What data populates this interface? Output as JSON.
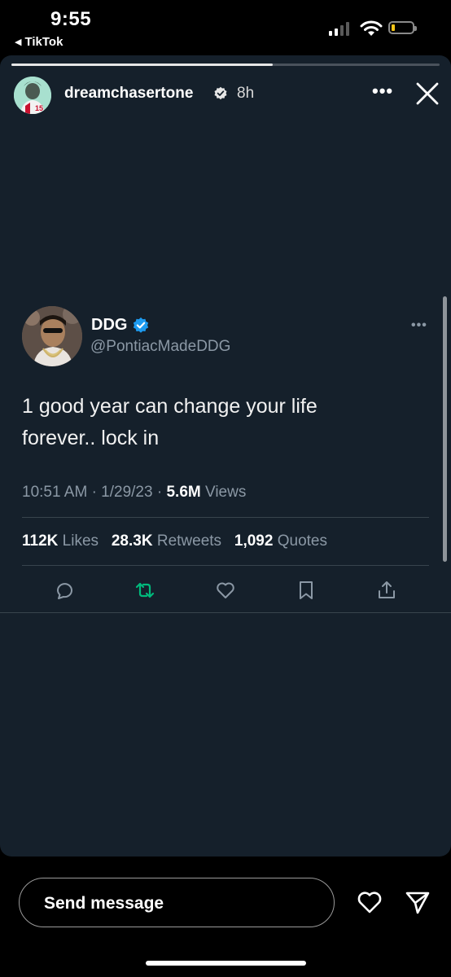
{
  "status_bar": {
    "time": "9:55",
    "back_app": "TikTok",
    "back_arrow": "◀",
    "signal_icon": "cellular-signal-icon",
    "wifi_icon": "wifi-icon",
    "battery_icon": "battery-low-icon",
    "battery_color": "#f5c518"
  },
  "story": {
    "progress_fraction": 0.61,
    "username": "dreamchasertone",
    "verified_icon": "verified-badge-icon",
    "age": "8h",
    "more_label": "•••",
    "close_icon": "close-icon",
    "background": "#15202b"
  },
  "tweet": {
    "name": "DDG",
    "handle": "@PontiacMadeDDG",
    "more_label": "•••",
    "text_lines": [
      "1 good year can change your life",
      "forever.. lock in"
    ],
    "time": "10:51 AM",
    "date": "1/29/23",
    "sep": "·",
    "views_count": "5.6M",
    "views_label": "Views",
    "likes_count": "112K",
    "likes_label": "Likes",
    "retweets_count": "28.3K",
    "retweets_label": "Retweets",
    "quotes_count": "1,092",
    "quotes_label": "Quotes",
    "actions": [
      "reply-icon",
      "retweet-icon",
      "like-icon",
      "bookmark-icon",
      "share-icon"
    ],
    "retweet_color": "#00ba7c",
    "verified_color": "#1d9bf0"
  },
  "bottom_bar": {
    "send_placeholder": "Send message",
    "like_icon": "heart-icon",
    "share_icon": "send-icon"
  }
}
